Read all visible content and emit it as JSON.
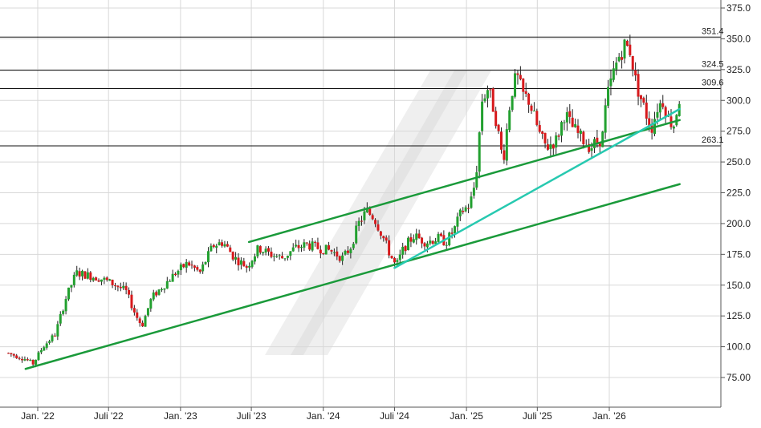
{
  "chart_data": {
    "type": "candlestick",
    "title": "",
    "xlabel": "",
    "ylabel": "",
    "ylim": [
      60,
      380
    ],
    "grid": true,
    "x_ticks": [
      {
        "label": "Jan. '22",
        "date": "2022-01-01"
      },
      {
        "label": "Juli '22",
        "date": "2022-07-01"
      },
      {
        "label": "Jan. '23",
        "date": "2023-01-01"
      },
      {
        "label": "Juli '23",
        "date": "2023-07-01"
      },
      {
        "label": "Jan. '24",
        "date": "2024-01-01"
      },
      {
        "label": "Juli '24",
        "date": "2024-07-01"
      },
      {
        "label": "Jan. '25",
        "date": "2025-01-01"
      },
      {
        "label": "Juli '25",
        "date": "2025-07-01"
      },
      {
        "label": "Jan. '26",
        "date": "2026-01-01"
      }
    ],
    "y_ticks": [
      "75.00",
      "100.0",
      "125.0",
      "150.0",
      "175.0",
      "200.0",
      "225.0",
      "250.0",
      "275.0",
      "300.0",
      "325.0",
      "350.0",
      "375.0"
    ],
    "horizontal_levels": [
      {
        "label": "351.4",
        "value": 351.4
      },
      {
        "label": "324.5",
        "value": 324.5
      },
      {
        "label": "309.6",
        "value": 309.6
      },
      {
        "label": "263.1",
        "value": 263.1
      }
    ],
    "trendlines": [
      {
        "color": "#1a9a3a",
        "points": [
          [
            "2021-12-01",
            82
          ],
          [
            "2026-06-30",
            232
          ]
        ]
      },
      {
        "color": "#1a9a3a",
        "points": [
          [
            "2023-06-25",
            185
          ],
          [
            "2026-06-30",
            284
          ]
        ]
      },
      {
        "color": "#27c9b0",
        "points": [
          [
            "2024-07-01",
            164
          ],
          [
            "2026-06-30",
            293
          ]
        ]
      }
    ],
    "colors": {
      "up": "#22a02f",
      "down": "#d7191c",
      "wick": "#222222",
      "level": "#111111",
      "grid": "#d8d8d8"
    },
    "price_anchors": [
      [
        "2021-10-15",
        95
      ],
      [
        "2021-12-01",
        90
      ],
      [
        "2021-12-20",
        86
      ],
      [
        "2022-01-15",
        100
      ],
      [
        "2022-02-15",
        110
      ],
      [
        "2022-03-15",
        140
      ],
      [
        "2022-04-10",
        160
      ],
      [
        "2022-05-10",
        158
      ],
      [
        "2022-06-15",
        155
      ],
      [
        "2022-07-20",
        150
      ],
      [
        "2022-08-15",
        145
      ],
      [
        "2022-09-10",
        125
      ],
      [
        "2022-09-25",
        117
      ],
      [
        "2022-10-20",
        140
      ],
      [
        "2022-11-20",
        150
      ],
      [
        "2022-12-20",
        160
      ],
      [
        "2023-01-20",
        168
      ],
      [
        "2023-02-20",
        160
      ],
      [
        "2023-03-25",
        182
      ],
      [
        "2023-04-20",
        185
      ],
      [
        "2023-05-20",
        172
      ],
      [
        "2023-06-20",
        165
      ],
      [
        "2023-07-20",
        180
      ],
      [
        "2023-08-20",
        175
      ],
      [
        "2023-09-20",
        172
      ],
      [
        "2023-10-20",
        180
      ],
      [
        "2023-11-20",
        183
      ],
      [
        "2023-12-20",
        180
      ],
      [
        "2024-01-20",
        178
      ],
      [
        "2024-02-20",
        172
      ],
      [
        "2024-03-10",
        180
      ],
      [
        "2024-04-01",
        200
      ],
      [
        "2024-04-20",
        210
      ],
      [
        "2024-05-10",
        205
      ],
      [
        "2024-06-01",
        190
      ],
      [
        "2024-06-20",
        175
      ],
      [
        "2024-07-05",
        165
      ],
      [
        "2024-07-25",
        180
      ],
      [
        "2024-08-20",
        190
      ],
      [
        "2024-09-20",
        185
      ],
      [
        "2024-10-20",
        188
      ],
      [
        "2024-11-10",
        185
      ],
      [
        "2024-12-01",
        195
      ],
      [
        "2024-12-20",
        210
      ],
      [
        "2025-01-10",
        215
      ],
      [
        "2025-01-25",
        235
      ],
      [
        "2025-02-10",
        300
      ],
      [
        "2025-02-25",
        310
      ],
      [
        "2025-03-15",
        290
      ],
      [
        "2025-04-05",
        250
      ],
      [
        "2025-04-25",
        305
      ],
      [
        "2025-05-10",
        320
      ],
      [
        "2025-05-25",
        305
      ],
      [
        "2025-06-10",
        300
      ],
      [
        "2025-06-25",
        285
      ],
      [
        "2025-07-10",
        270
      ],
      [
        "2025-07-25",
        262
      ],
      [
        "2025-08-20",
        268
      ],
      [
        "2025-09-10",
        290
      ],
      [
        "2025-09-25",
        280
      ],
      [
        "2025-10-20",
        270
      ],
      [
        "2025-11-15",
        262
      ],
      [
        "2025-12-15",
        270
      ],
      [
        "2025-12-25",
        300
      ],
      [
        "2026-01-10",
        320
      ],
      [
        "2026-01-25",
        335
      ],
      [
        "2026-02-10",
        345
      ],
      [
        "2026-02-25",
        340
      ],
      [
        "2026-03-10",
        315
      ],
      [
        "2026-03-25",
        300
      ],
      [
        "2026-04-10",
        285
      ],
      [
        "2026-04-20",
        278
      ],
      [
        "2026-05-05",
        295
      ],
      [
        "2026-05-20",
        300
      ],
      [
        "2026-06-01",
        285
      ],
      [
        "2026-06-15",
        280
      ],
      [
        "2026-06-30",
        302
      ]
    ]
  }
}
